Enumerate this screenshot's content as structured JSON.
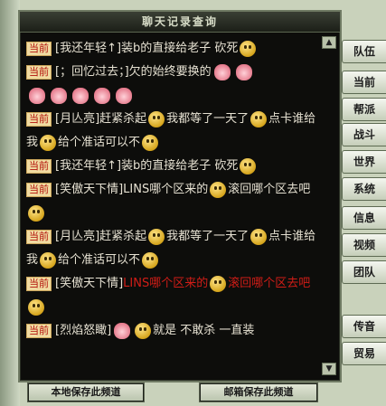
{
  "window": {
    "title": "聊天记录查询",
    "scroll_up_glyph": "▲",
    "scroll_down_glyph": "▼"
  },
  "messages": [
    {
      "tag": "当前",
      "text_a": "[我还年轻↑]装b的直接给老子 砍死",
      "emoji_a": "smiley-face",
      "text_b": "",
      "emoji_b": "",
      "text_c": ""
    },
    {
      "tag": "当前",
      "text_a": "[；回忆过去；]欠的始终要换的",
      "emoji_a": "pig-face",
      "text_b": "",
      "emoji_b": "",
      "text_c": ""
    },
    {
      "tag": "当前",
      "text_a": "[月亾亮]赶紧杀起",
      "emoji_a": "smiley-face",
      "text_b": "我都等了一天了",
      "emoji_b": "smiley-face",
      "text_c": "点卡谁给我"
    },
    {
      "tag": "当前",
      "text_a": "[我还年轻↑]装b的直接给老子 砍死",
      "emoji_a": "smiley-face",
      "text_b": "",
      "emoji_b": "",
      "text_c": ""
    },
    {
      "tag": "当前",
      "text_a": "[笑傲天下情]LINS哪个区来的",
      "emoji_a": "smiley-face",
      "text_b": "滚回哪个区去吧",
      "emoji_b": "smiley-face",
      "text_c": ""
    },
    {
      "tag": "当前",
      "text_a": "[月亾亮]赶紧杀起",
      "emoji_a": "smiley-face",
      "text_b": "我都等了一天了",
      "emoji_b": "smiley-face",
      "text_c": "点卡谁给我"
    },
    {
      "tag": "当前",
      "text_a": "[笑傲天下情]",
      "emoji_a": "",
      "text_b": "LINS哪个区来的",
      "emoji_b": "smiley-face",
      "text_c": "滚回哪个区去吧"
    },
    {
      "tag": "当前",
      "text_a": "[烈焰怒瞰]",
      "emoji_a": "pig-face",
      "text_b": "就是 不敢杀 一直装",
      "emoji_b": "",
      "text_c": ""
    }
  ],
  "extra": {
    "line2_tail": "给个准话可以不",
    "line4_tail": "给个准话可以不"
  },
  "buttons": {
    "save_local": "本地保存此频道",
    "save_mail": "邮箱保存此频道"
  },
  "side_tabs": [
    "队伍",
    "当前",
    "帮派",
    "战斗",
    "世界",
    "系统",
    "信息",
    "视频",
    "团队",
    "传音",
    "贸易"
  ],
  "colors": {
    "tag_bg": "#f0dba1",
    "tag_text": "#b3120d",
    "red_text": "#d11d17",
    "log_bg": "#0d0d0b"
  }
}
